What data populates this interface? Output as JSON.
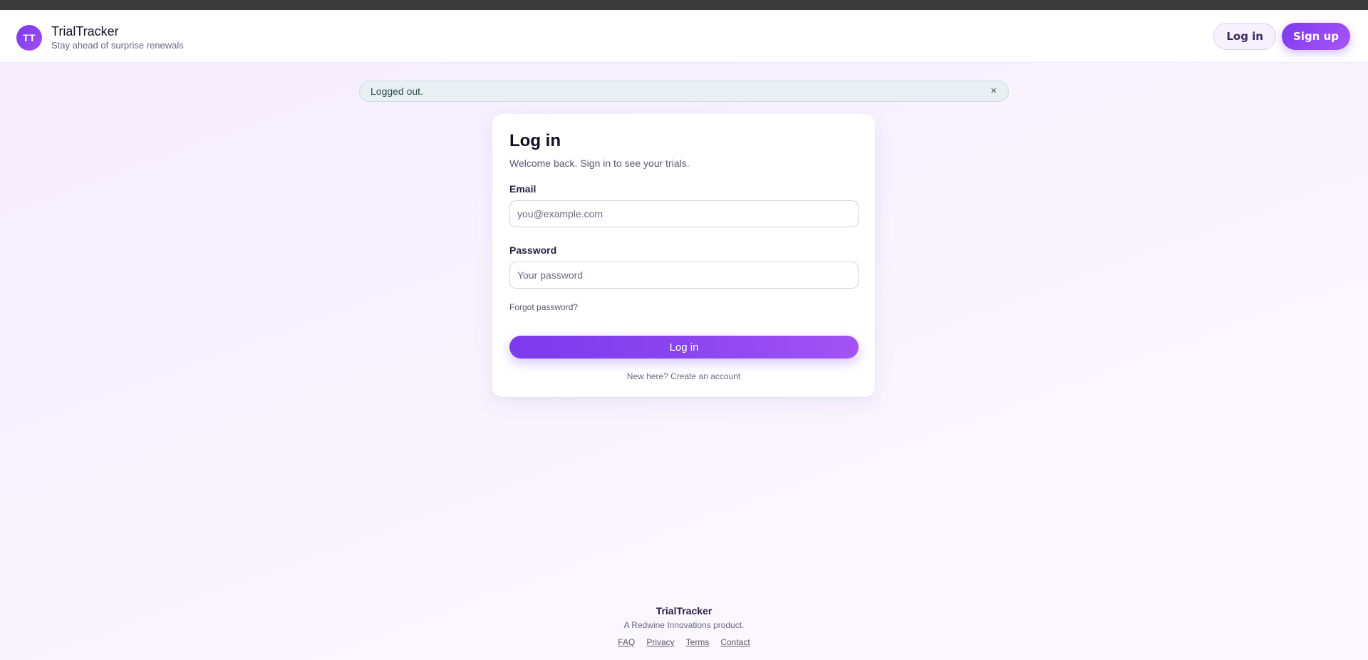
{
  "header": {
    "avatar_initials": "TT",
    "app_name": "TrialTracker",
    "tagline": "Stay ahead of surprise renewals",
    "login_label": "Log in",
    "signup_label": "Sign up"
  },
  "alert": {
    "message": "Logged out.",
    "close_symbol": "×"
  },
  "login_card": {
    "title": "Log in",
    "subtitle": "Welcome back. Sign in to see your trials.",
    "email_label": "Email",
    "email_placeholder": "you@example.com",
    "email_value": "",
    "password_label": "Password",
    "password_placeholder": "Your password",
    "password_value": "",
    "forgot_label": "Forgot password?",
    "submit_label": "Log in",
    "signup_prompt": "New here?",
    "signup_link": "Create an account"
  },
  "footer": {
    "name": "TrialTracker",
    "tagline": "A Redwine Innovations product.",
    "links": [
      "FAQ",
      "Privacy",
      "Terms",
      "Contact"
    ]
  },
  "colors": {
    "accent": "#7c3aed",
    "accent_light": "#a855f7",
    "alert_bg": "#e9f0f4"
  }
}
